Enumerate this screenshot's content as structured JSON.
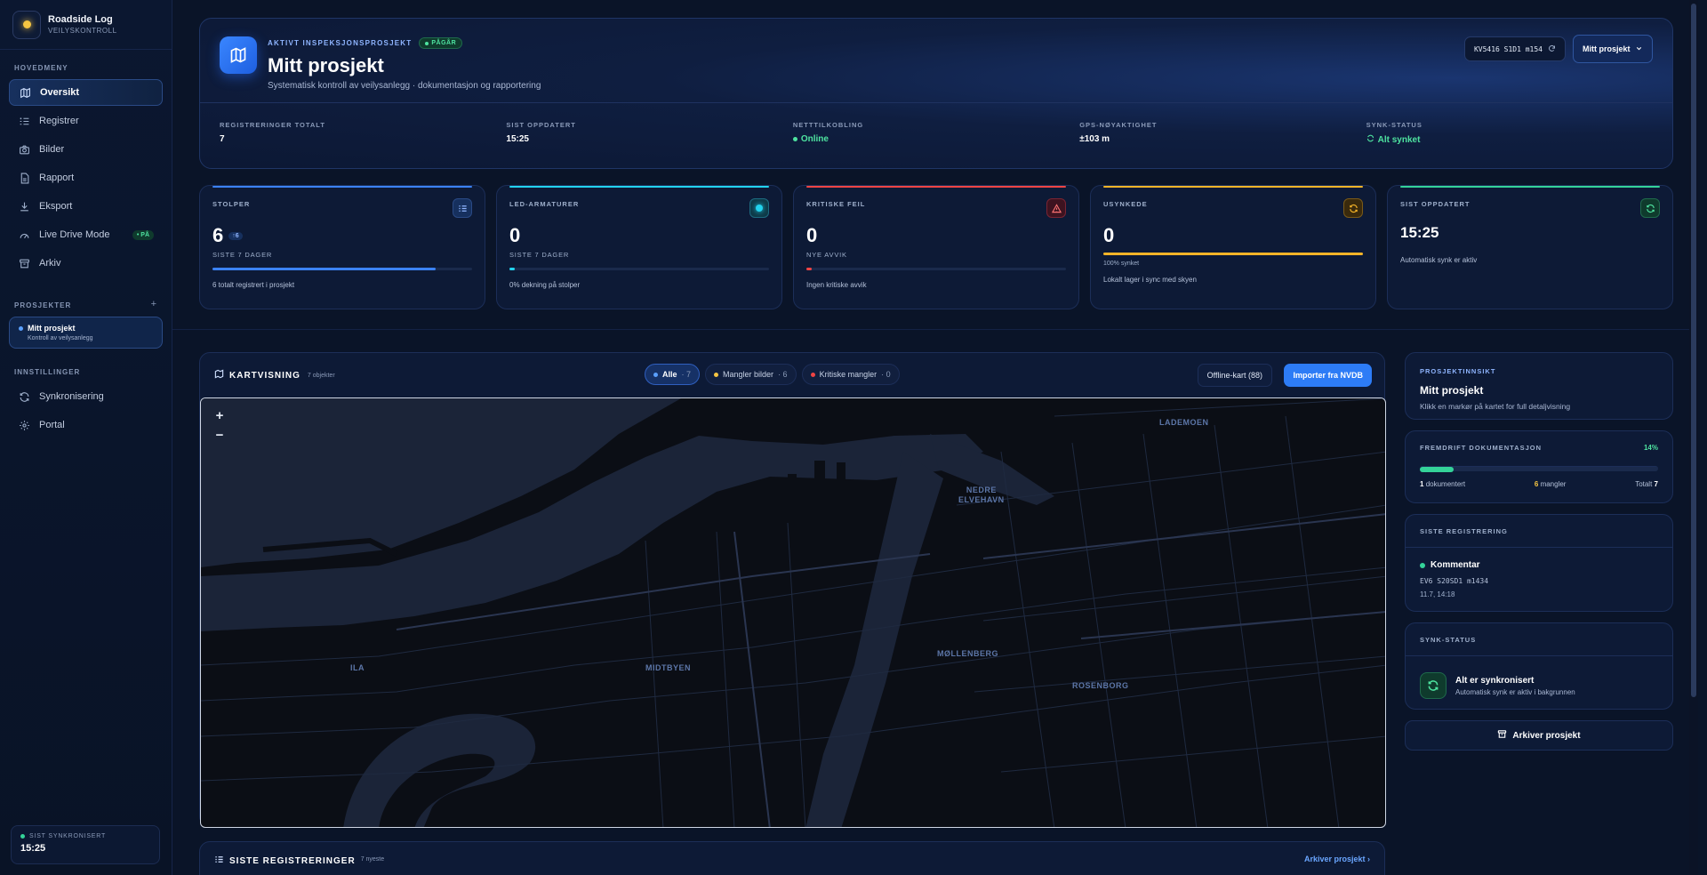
{
  "app": {
    "title": "Roadside Log",
    "subtitle": "VEILYSKONTROLL"
  },
  "sidebar": {
    "main_section": "HOVEDMENY",
    "items": [
      {
        "label": "Oversikt",
        "icon": "map-icon"
      },
      {
        "label": "Registrer",
        "icon": "list-plus-icon"
      },
      {
        "label": "Bilder",
        "icon": "camera-icon"
      },
      {
        "label": "Rapport",
        "icon": "document-icon"
      },
      {
        "label": "Eksport",
        "icon": "download-icon"
      },
      {
        "label": "Live Drive Mode",
        "icon": "speedometer-icon",
        "badge": "• PÅ"
      },
      {
        "label": "Arkiv",
        "icon": "archive-icon"
      }
    ],
    "projects_section": "PROSJEKTER",
    "projects_add": "+",
    "project": {
      "name": "Mitt prosjekt",
      "sub": "Kontroll av veilysanlegg"
    },
    "settings_section": "INNSTILLINGER",
    "settings": [
      {
        "label": "Synkronisering",
        "icon": "sync-icon"
      },
      {
        "label": "Portal",
        "icon": "gear-icon"
      }
    ],
    "sync": {
      "label": "SIST SYNKRONISERT",
      "value": "15:25"
    }
  },
  "hero": {
    "kicker": "AKTIVT INSPEKSJONSPROSJEKT",
    "status": "PÅGÅR",
    "title": "Mitt prosjekt",
    "subtitle": "Systematisk kontroll av veilysanlegg · dokumentasjon og rapportering",
    "ref": "KV5416 S1D1 m154",
    "select": "Mitt prosjekt",
    "stats": [
      {
        "label": "REGISTRERINGER TOTALT",
        "value": "7"
      },
      {
        "label": "SIST OPPDATERT",
        "value": "15:25"
      },
      {
        "label": "NETTTILKOBLING",
        "value": "Online"
      },
      {
        "label": "GPS-NØYAKTIGHET",
        "value": "±103 m"
      },
      {
        "label": "SYNK-STATUS",
        "value": "Alt synket"
      }
    ]
  },
  "kpis": [
    {
      "label": "STOLPER",
      "value": "6",
      "chip": "↑6",
      "sub": "SISTE 7 DAGER",
      "note": "6 totalt registrert i prosjekt",
      "progress": 0.86,
      "color": "#3b82f6"
    },
    {
      "label": "LED-ARMATURER",
      "value": "0",
      "sub": "SISTE 7 DAGER",
      "note": "0% dekning på stolper",
      "progress": 0.02,
      "color": "#22d3ee"
    },
    {
      "label": "KRITISKE FEIL",
      "value": "0",
      "sub": "NYE AVVIK",
      "note": "Ingen kritiske avvik",
      "progress": 0.02,
      "color": "#ef4444"
    },
    {
      "label": "USYNKEDE",
      "value": "0",
      "sub": "100% synket",
      "note": "Lokalt lager i sync med skyen",
      "progress": 1.0,
      "color": "#f5b428"
    },
    {
      "label": "SIST OPPDATERT",
      "value": "15:25",
      "note": "Automatisk synk er aktiv",
      "color": "#34d399"
    }
  ],
  "map": {
    "title": "KARTVISNING",
    "count": "7 objekter",
    "filters": [
      {
        "label": "Alle",
        "count": "· 7",
        "color": "#5aa0ff"
      },
      {
        "label": "Mangler bilder",
        "count": "· 6",
        "color": "#f5c542"
      },
      {
        "label": "Kritiske mangler",
        "count": "· 0",
        "color": "#ef4444"
      }
    ],
    "offline": "Offline-kart (88)",
    "import": "Importer fra NVDB",
    "zoom_in": "+",
    "zoom_out": "−",
    "labels": [
      {
        "text": "LADEMOEN"
      },
      {
        "text": "NEDRE\nELVEHAVN"
      },
      {
        "text": "MIDTBYEN"
      },
      {
        "text": "MØLLENBERG"
      },
      {
        "text": "ROSENBORG"
      },
      {
        "text": "ILA"
      }
    ]
  },
  "insight": {
    "kicker": "PROSJEKTINNSIKT",
    "title": "Mitt prosjekt",
    "sub": "Klikk en markør på kartet for full detaljvisning"
  },
  "progress": {
    "kicker": "FREMDRIFT DOKUMENTASJON",
    "percent": "14%",
    "fraction": 0.14,
    "documented_n": "1",
    "documented_label": "dokumentert",
    "missing_n": "6",
    "missing_label": "mangler",
    "total_label": "Totalt",
    "total_n": "7"
  },
  "latest": {
    "kicker": "SISTE REGISTRERING",
    "title": "Kommentar",
    "code": "EV6 S20SD1 m1434",
    "time": "11.7, 14:18"
  },
  "sync_status": {
    "kicker": "SYNK-STATUS",
    "title": "Alt er synkronisert",
    "sub": "Automatisk synk er aktiv i bakgrunnen"
  },
  "archive": {
    "label": "Arkiver prosjekt"
  },
  "recent": {
    "title": "SISTE REGISTRERINGER",
    "count": "7 nyeste",
    "link": "Arkiver prosjekt ›"
  }
}
